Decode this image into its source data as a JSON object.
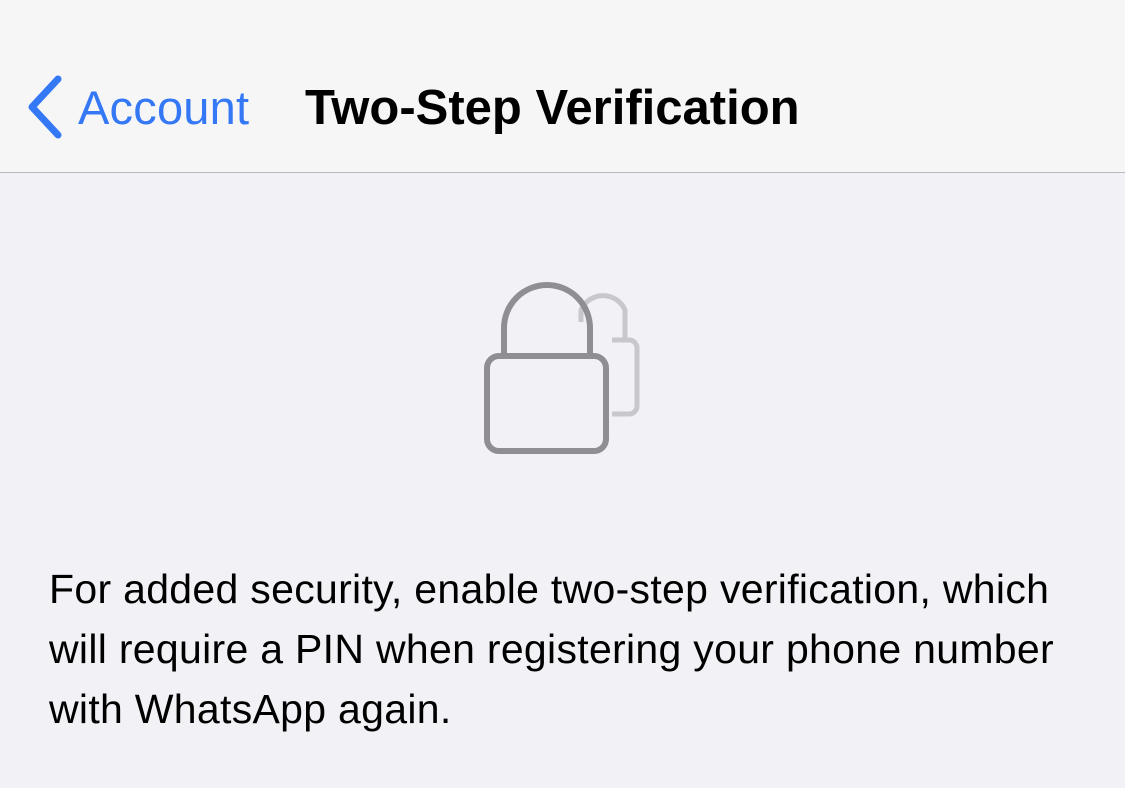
{
  "navbar": {
    "back_label": "Account",
    "title": "Two-Step Verification"
  },
  "illustration": {
    "icon": "stacked-padlock-icon"
  },
  "description": {
    "text": "For added security, enable two-step verification, which will require a PIN when registering your phone number with WhatsApp again."
  },
  "colors": {
    "accent": "#3478f6",
    "background": "#f1f1f6",
    "navbar_background": "#f6f6f7",
    "icon_gray": "#8e8e93"
  }
}
